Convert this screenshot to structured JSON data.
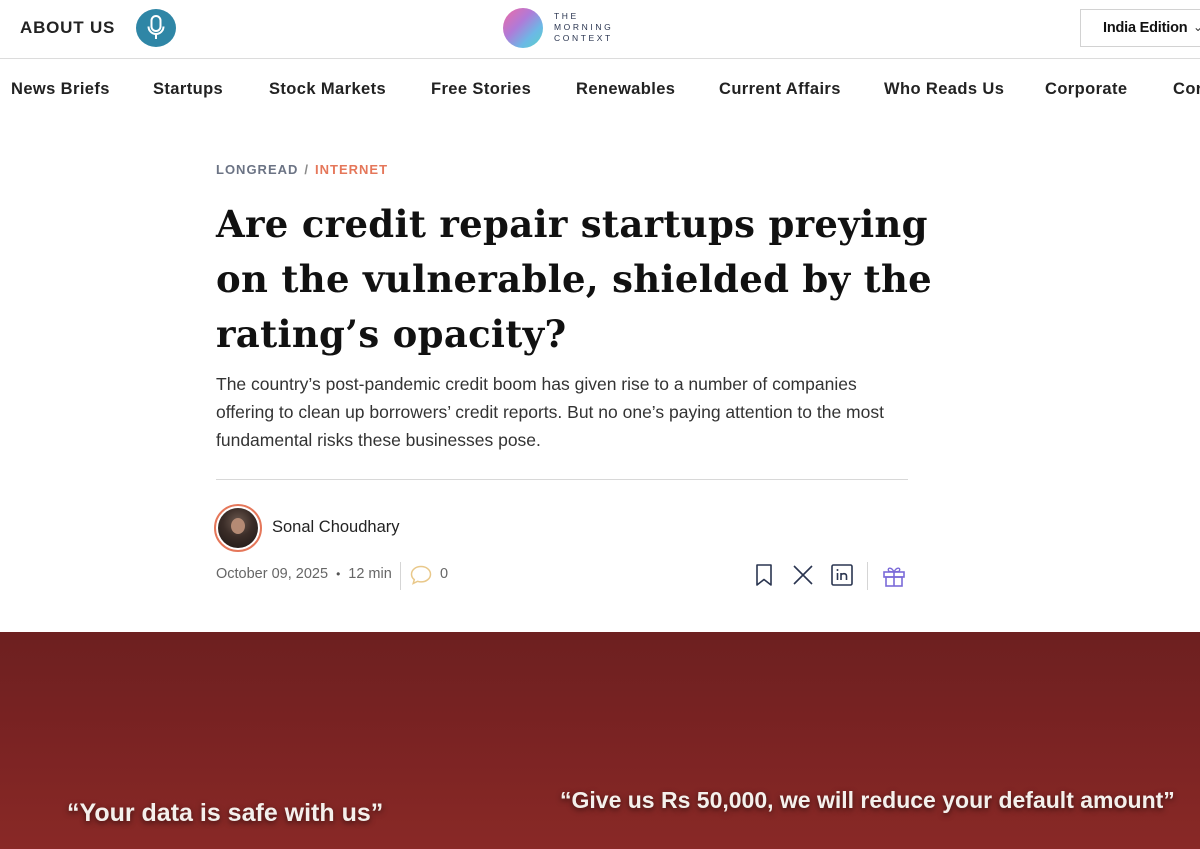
{
  "header": {
    "about_label": "ABOUT US",
    "logo_lines": [
      "THE",
      "MORNING",
      "CONTEXT"
    ],
    "edition_label": "India Edition"
  },
  "nav": {
    "items": [
      "News Briefs",
      "Startups",
      "Stock Markets",
      "Free Stories",
      "Renewables",
      "Current Affairs",
      "Who Reads Us",
      "Corporate",
      "Cor"
    ]
  },
  "article": {
    "category": "LONGREAD",
    "separator": "/",
    "topic": "INTERNET",
    "title": "Are credit repair startups preying on the vulnerable, shielded by the rating’s opacity?",
    "dek": "The country’s post-pandemic credit boom has given rise to a number of companies offering to clean up borrowers’ credit reports. But no one’s paying attention to the most fundamental risks these businesses pose.",
    "author": "Sonal Choudhary",
    "date": "October 09, 2025",
    "read_time": "12 min",
    "comment_count": "0"
  },
  "banner": {
    "quote_left": "“Your data is safe with us”",
    "quote_right": "“Give us Rs 50,000, we will reduce your default amount”"
  },
  "icons": {
    "mic": "microphone-icon",
    "comment": "comment-bubble-icon",
    "bookmark": "bookmark-icon",
    "x": "x-share-icon",
    "linkedin": "linkedin-icon",
    "gift": "gift-icon"
  },
  "colors": {
    "accent": "#e5775a",
    "mic_bg": "#2f86a6",
    "gift": "#7b6ad8",
    "banner": "#7b2323"
  }
}
